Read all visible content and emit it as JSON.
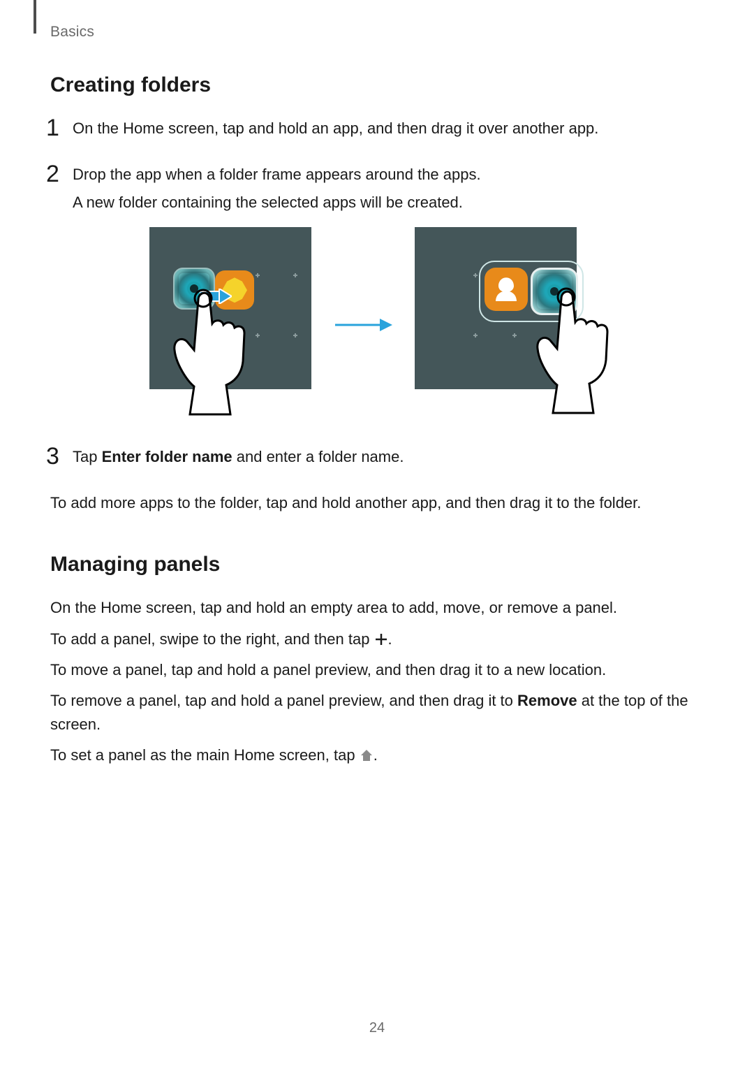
{
  "breadcrumb": "Basics",
  "section1_title": "Creating folders",
  "step1": "On the Home screen, tap and hold an app, and then drag it over another app.",
  "step2a": "Drop the app when a folder frame appears around the apps.",
  "step2b": "A new folder containing the selected apps will be created.",
  "step3_prefix": "Tap ",
  "step3_bold": "Enter folder name",
  "step3_suffix": " and enter a folder name.",
  "after_steps": "To add more apps to the folder, tap and hold another app, and then drag it to the folder.",
  "section2_title": "Managing panels",
  "mp_line1": "On the Home screen, tap and hold an empty area to add, move, or remove a panel.",
  "mp_line2_a": "To add a panel, swipe to the right, and then tap ",
  "mp_line2_b": ".",
  "mp_line3": "To move a panel, tap and hold a panel preview, and then drag it to a new location.",
  "mp_line4_a": "To remove a panel, tap and hold a panel preview, and then drag it to ",
  "mp_line4_bold": "Remove",
  "mp_line4_b": " at the top of the screen.",
  "mp_line5_a": "To set a panel as the main Home screen, tap ",
  "mp_line5_b": ".",
  "page_number": "24",
  "numbers": {
    "one": "1",
    "two": "2",
    "three": "3"
  }
}
